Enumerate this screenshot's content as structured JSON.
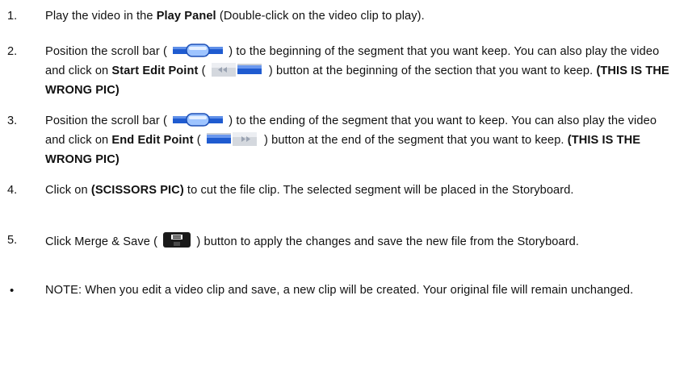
{
  "steps": [
    {
      "num": "1.",
      "parts": [
        {
          "t": "Play the video in the "
        },
        {
          "t": "Play Panel",
          "b": true
        },
        {
          "t": " (Double-click on the video clip to play)."
        }
      ]
    },
    {
      "num": "2.",
      "parts": [
        {
          "t": "Position the scroll bar ( "
        },
        {
          "icon": "scrollbar-icon"
        },
        {
          "t": " ) to the beginning of the segment that you want keep. You can also play the video and click on "
        },
        {
          "t": "Start Edit Point",
          "b": true
        },
        {
          "t": " ( "
        },
        {
          "icon": "start-edit-point-icon"
        },
        {
          "t": " ) button at the beginning of the section that you want to keep. "
        },
        {
          "t": "(THIS IS THE WRONG PIC)",
          "b": true
        }
      ]
    },
    {
      "num": "3.",
      "parts": [
        {
          "t": "Position the scroll bar ( "
        },
        {
          "icon": "scrollbar-icon"
        },
        {
          "t": " ) to the ending of the segment that you want to keep.   You can also play the video and click on "
        },
        {
          "t": "End Edit Point",
          "b": true
        },
        {
          "t": " ( "
        },
        {
          "icon": "end-edit-point-icon"
        },
        {
          "t": " ) button at the end of the segment that you want to keep. "
        },
        {
          "t": "(THIS IS THE WRONG PIC)",
          "b": true
        }
      ]
    },
    {
      "num": "4.",
      "parts": [
        {
          "t": "Click on "
        },
        {
          "t": "(SCISSORS PIC)",
          "b": true
        },
        {
          "t": " to cut the file clip.   The selected segment will be placed in the Storyboard."
        }
      ]
    },
    {
      "num": "5.",
      "parts": [
        {
          "t": "Click Merge & Save ( "
        },
        {
          "icon": "save-disk-icon"
        },
        {
          "t": " ) button to apply the changes and save the new file from the Storyboard."
        }
      ]
    }
  ],
  "note": {
    "bullet": "•",
    "text": "NOTE: When you edit a video clip and save, a new clip will be created.   Your original file will remain unchanged."
  },
  "colors": {
    "scroll_blue": "#1f5bd0",
    "scroll_light": "#9ec4ff",
    "button_gray": "#c9ced6",
    "disk_black": "#111111"
  }
}
